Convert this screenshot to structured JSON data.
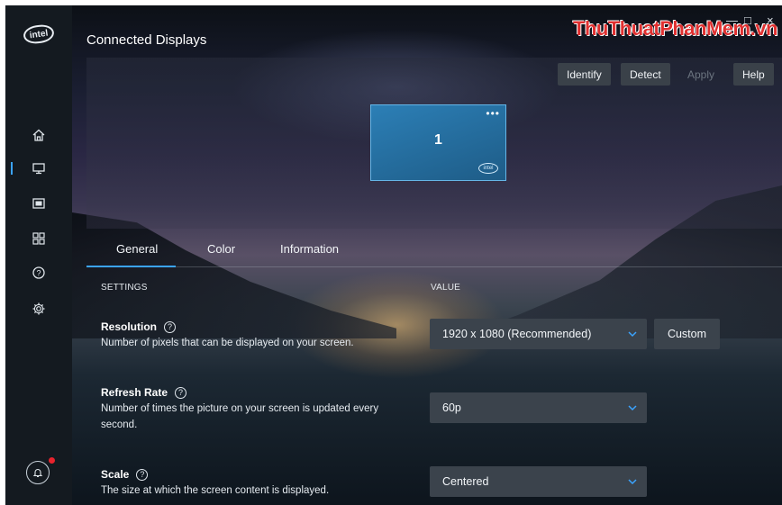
{
  "window": {
    "title": "Connected Displays",
    "watermark": "ThuThuatPhanMem.vn",
    "controls": {
      "minimize": "—",
      "maximize": "□",
      "close": "×"
    }
  },
  "sidebar": {
    "logo_text": "intel",
    "items": [
      {
        "name": "home",
        "icon": "home-icon"
      },
      {
        "name": "display",
        "icon": "monitor-icon",
        "active": true
      },
      {
        "name": "video",
        "icon": "video-icon"
      },
      {
        "name": "apps",
        "icon": "apps-grid-icon"
      },
      {
        "name": "help",
        "icon": "help-circle-icon"
      },
      {
        "name": "settings",
        "icon": "gear-icon"
      }
    ],
    "notification": {
      "icon": "bell-icon",
      "badge_color": "#e8232d"
    }
  },
  "toolbar": {
    "identify": "Identify",
    "detect": "Detect",
    "apply": "Apply",
    "help": "Help"
  },
  "display": {
    "number": "1",
    "menu": "•••",
    "logo_text": "intel"
  },
  "tabs": [
    {
      "label": "General",
      "active": true
    },
    {
      "label": "Color"
    },
    {
      "label": "Information"
    }
  ],
  "table": {
    "settings_header": "SETTINGS",
    "value_header": "VALUE"
  },
  "settings": {
    "resolution": {
      "title": "Resolution",
      "description": "Number of pixels that can be displayed on your screen.",
      "value": "1920 x 1080 (Recommended)",
      "custom_label": "Custom"
    },
    "refresh": {
      "title": "Refresh Rate",
      "description": "Number of times the picture on your screen is updated every second.",
      "value": "60p"
    },
    "scale": {
      "title": "Scale",
      "description": "The size at which the screen content is displayed.",
      "value": "Centered"
    }
  },
  "colors": {
    "accent": "#3ba4ff",
    "display_tile": "#2c7fb6",
    "notification_dot": "#e8232d",
    "watermark": "#e03030"
  }
}
